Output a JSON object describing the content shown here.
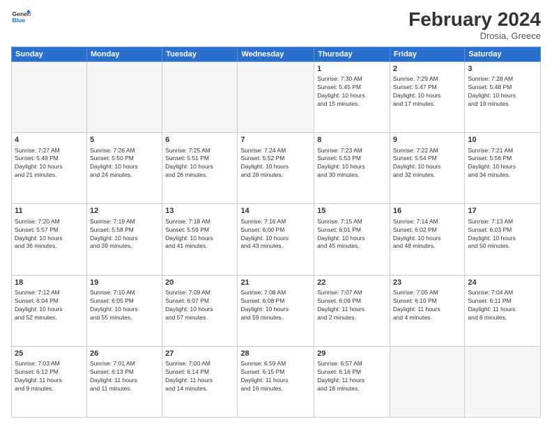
{
  "header": {
    "logo_line1": "General",
    "logo_line2": "Blue",
    "title": "February 2024",
    "subtitle": "Drosia, Greece"
  },
  "weekdays": [
    "Sunday",
    "Monday",
    "Tuesday",
    "Wednesday",
    "Thursday",
    "Friday",
    "Saturday"
  ],
  "weeks": [
    [
      {
        "num": "",
        "info": "",
        "empty": true
      },
      {
        "num": "",
        "info": "",
        "empty": true
      },
      {
        "num": "",
        "info": "",
        "empty": true
      },
      {
        "num": "",
        "info": "",
        "empty": true
      },
      {
        "num": "1",
        "info": "Sunrise: 7:30 AM\nSunset: 5:45 PM\nDaylight: 10 hours\nand 15 minutes."
      },
      {
        "num": "2",
        "info": "Sunrise: 7:29 AM\nSunset: 5:47 PM\nDaylight: 10 hours\nand 17 minutes."
      },
      {
        "num": "3",
        "info": "Sunrise: 7:28 AM\nSunset: 5:48 PM\nDaylight: 10 hours\nand 19 minutes."
      }
    ],
    [
      {
        "num": "4",
        "info": "Sunrise: 7:27 AM\nSunset: 5:49 PM\nDaylight: 10 hours\nand 21 minutes."
      },
      {
        "num": "5",
        "info": "Sunrise: 7:26 AM\nSunset: 5:50 PM\nDaylight: 10 hours\nand 24 minutes."
      },
      {
        "num": "6",
        "info": "Sunrise: 7:25 AM\nSunset: 5:51 PM\nDaylight: 10 hours\nand 26 minutes."
      },
      {
        "num": "7",
        "info": "Sunrise: 7:24 AM\nSunset: 5:52 PM\nDaylight: 10 hours\nand 28 minutes."
      },
      {
        "num": "8",
        "info": "Sunrise: 7:23 AM\nSunset: 5:53 PM\nDaylight: 10 hours\nand 30 minutes."
      },
      {
        "num": "9",
        "info": "Sunrise: 7:22 AM\nSunset: 5:54 PM\nDaylight: 10 hours\nand 32 minutes."
      },
      {
        "num": "10",
        "info": "Sunrise: 7:21 AM\nSunset: 5:56 PM\nDaylight: 10 hours\nand 34 minutes."
      }
    ],
    [
      {
        "num": "11",
        "info": "Sunrise: 7:20 AM\nSunset: 5:57 PM\nDaylight: 10 hours\nand 36 minutes."
      },
      {
        "num": "12",
        "info": "Sunrise: 7:19 AM\nSunset: 5:58 PM\nDaylight: 10 hours\nand 39 minutes."
      },
      {
        "num": "13",
        "info": "Sunrise: 7:18 AM\nSunset: 5:59 PM\nDaylight: 10 hours\nand 41 minutes."
      },
      {
        "num": "14",
        "info": "Sunrise: 7:16 AM\nSunset: 6:00 PM\nDaylight: 10 hours\nand 43 minutes."
      },
      {
        "num": "15",
        "info": "Sunrise: 7:15 AM\nSunset: 6:01 PM\nDaylight: 10 hours\nand 45 minutes."
      },
      {
        "num": "16",
        "info": "Sunrise: 7:14 AM\nSunset: 6:02 PM\nDaylight: 10 hours\nand 48 minutes."
      },
      {
        "num": "17",
        "info": "Sunrise: 7:13 AM\nSunset: 6:03 PM\nDaylight: 10 hours\nand 50 minutes."
      }
    ],
    [
      {
        "num": "18",
        "info": "Sunrise: 7:12 AM\nSunset: 6:04 PM\nDaylight: 10 hours\nand 52 minutes."
      },
      {
        "num": "19",
        "info": "Sunrise: 7:10 AM\nSunset: 6:05 PM\nDaylight: 10 hours\nand 55 minutes."
      },
      {
        "num": "20",
        "info": "Sunrise: 7:09 AM\nSunset: 6:07 PM\nDaylight: 10 hours\nand 57 minutes."
      },
      {
        "num": "21",
        "info": "Sunrise: 7:08 AM\nSunset: 6:08 PM\nDaylight: 10 hours\nand 59 minutes."
      },
      {
        "num": "22",
        "info": "Sunrise: 7:07 AM\nSunset: 6:09 PM\nDaylight: 11 hours\nand 2 minutes."
      },
      {
        "num": "23",
        "info": "Sunrise: 7:05 AM\nSunset: 6:10 PM\nDaylight: 11 hours\nand 4 minutes."
      },
      {
        "num": "24",
        "info": "Sunrise: 7:04 AM\nSunset: 6:11 PM\nDaylight: 11 hours\nand 6 minutes."
      }
    ],
    [
      {
        "num": "25",
        "info": "Sunrise: 7:03 AM\nSunset: 6:12 PM\nDaylight: 11 hours\nand 9 minutes."
      },
      {
        "num": "26",
        "info": "Sunrise: 7:01 AM\nSunset: 6:13 PM\nDaylight: 11 hours\nand 11 minutes."
      },
      {
        "num": "27",
        "info": "Sunrise: 7:00 AM\nSunset: 6:14 PM\nDaylight: 11 hours\nand 14 minutes."
      },
      {
        "num": "28",
        "info": "Sunrise: 6:59 AM\nSunset: 6:15 PM\nDaylight: 11 hours\nand 16 minutes."
      },
      {
        "num": "29",
        "info": "Sunrise: 6:57 AM\nSunset: 6:16 PM\nDaylight: 11 hours\nand 18 minutes."
      },
      {
        "num": "",
        "info": "",
        "empty": true
      },
      {
        "num": "",
        "info": "",
        "empty": true
      }
    ]
  ]
}
